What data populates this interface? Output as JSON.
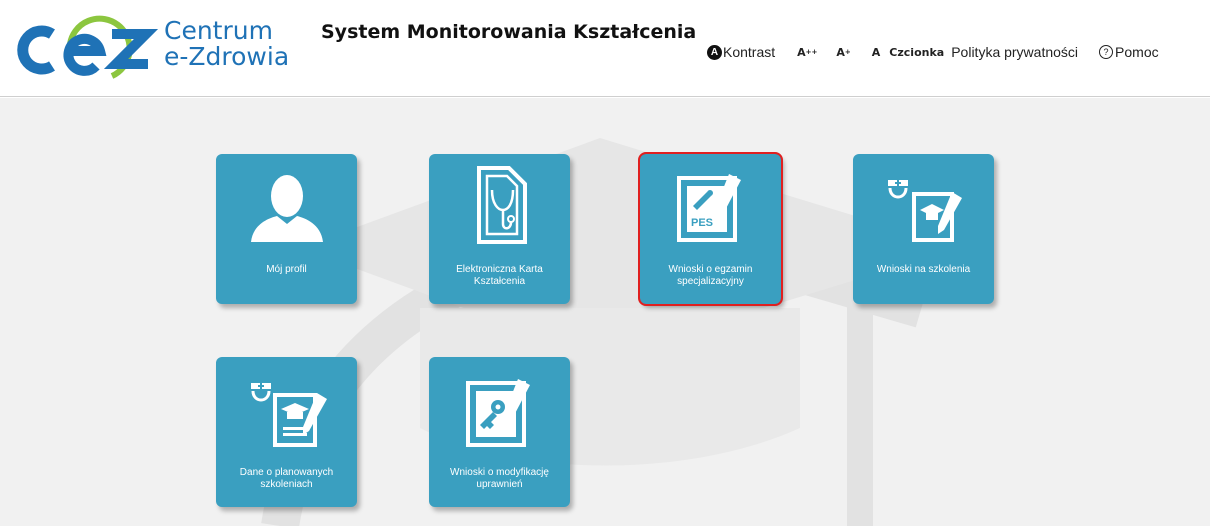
{
  "header": {
    "logo_abbr": "cez",
    "logo_line1": "Centrum",
    "logo_line2": "e-Zdrowia",
    "title": "System Monitorowania Kształcenia",
    "toolbar": {
      "kontrast_icon": "A",
      "kontrast_label": "Kontrast",
      "font_large": "A",
      "font_large_sup": "++",
      "font_medium": "A",
      "font_medium_sup": "+",
      "font_normal": "A",
      "czcionka": "Czcionka",
      "privacy": "Polityka prywatności",
      "help_icon": "?",
      "help": "Pomoc"
    }
  },
  "tiles": [
    {
      "label": "Mój profil",
      "icon": "user-profile-icon"
    },
    {
      "label": "Elektroniczna Karta Kształcenia",
      "icon": "education-card-icon"
    },
    {
      "label": "Wnioski o egzamin specjalizacyjny",
      "icon": "pes-exam-icon",
      "selected": true
    },
    {
      "label": "Wnioski na szkolenia",
      "icon": "nurse-training-icon"
    },
    {
      "label": "Dane o planowanych szkoleniach",
      "icon": "planned-training-icon"
    },
    {
      "label": "Wnioski o modyfikację uprawnień",
      "icon": "key-permissions-icon"
    }
  ],
  "icon_texts": {
    "pes": "PES"
  },
  "colors": {
    "tile": "#3a9fc0",
    "brand_green": "#8cc63f",
    "brand_blue": "#1f72b6",
    "selected_outline": "#e02020"
  }
}
